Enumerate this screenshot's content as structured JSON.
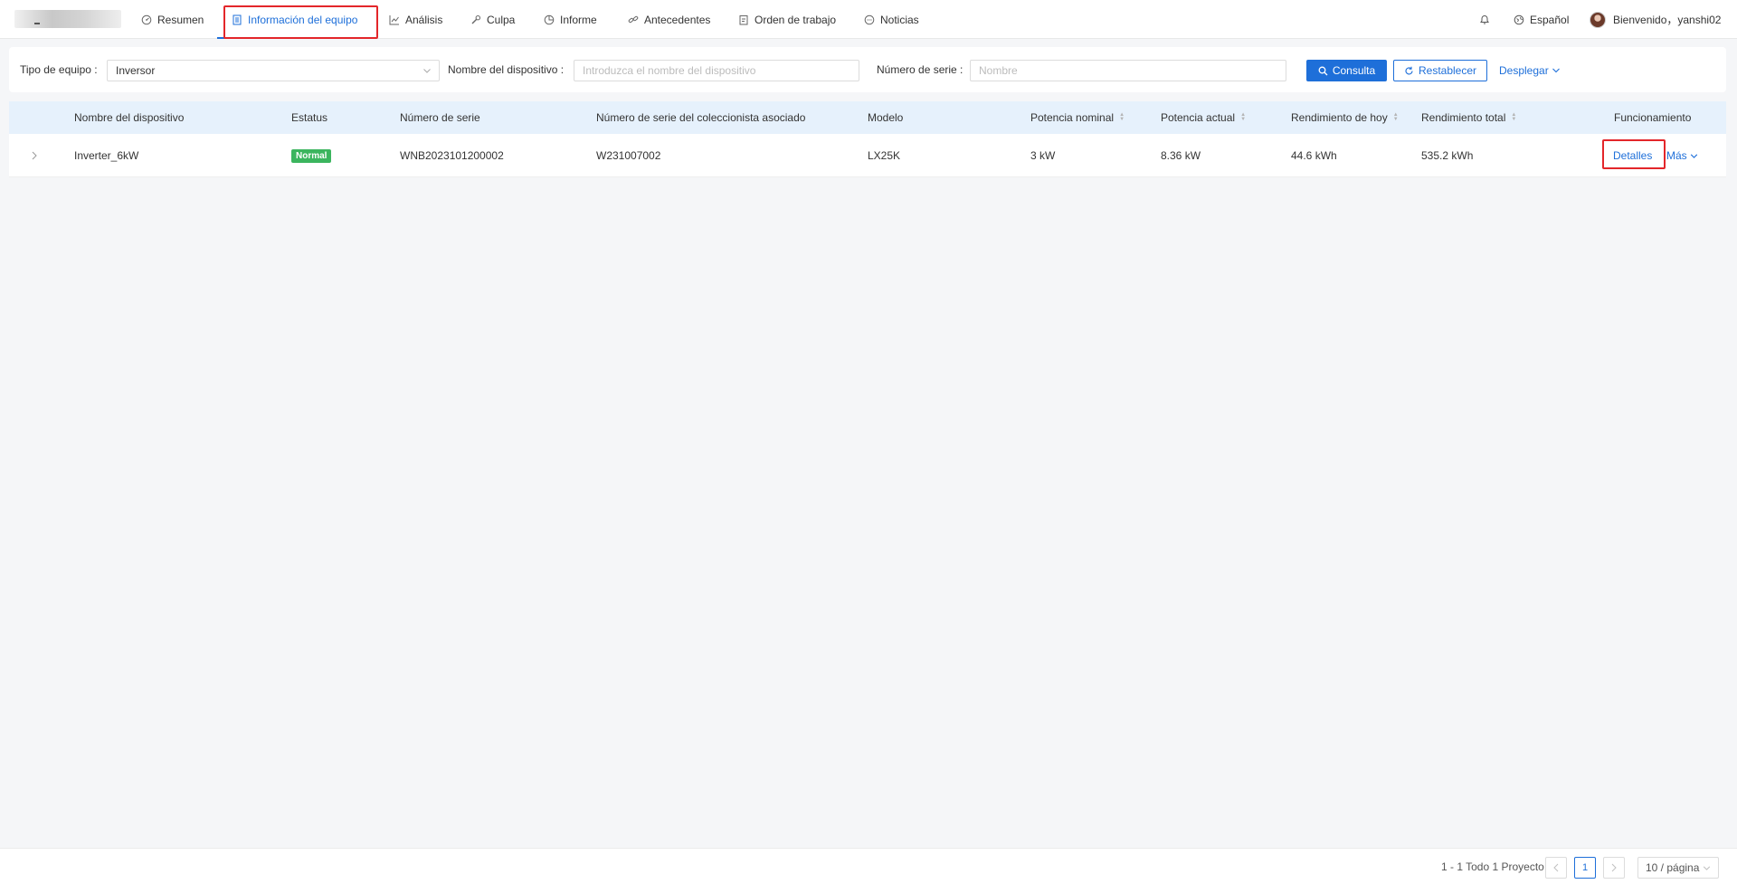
{
  "nav": {
    "items": [
      {
        "label": "Resumen",
        "icon": "gauge-icon"
      },
      {
        "label": "Información del equipo",
        "icon": "document-icon"
      },
      {
        "label": "Análisis",
        "icon": "line-chart-icon"
      },
      {
        "label": "Culpa",
        "icon": "wrench-icon"
      },
      {
        "label": "Informe",
        "icon": "pie-chart-icon"
      },
      {
        "label": "Antecedentes",
        "icon": "link-icon"
      },
      {
        "label": "Orden de trabajo",
        "icon": "clipboard-icon"
      },
      {
        "label": "Noticias",
        "icon": "chat-icon"
      }
    ],
    "active_index": 1,
    "language": "Español",
    "welcome": "Bienvenido，yanshi02"
  },
  "filter": {
    "type_label": "Tipo de equipo :",
    "type_value": "Inversor",
    "name_label": "Nombre del dispositivo :",
    "name_placeholder": "Introduzca el nombre del dispositivo",
    "serial_label": "Número de serie :",
    "serial_placeholder": "Nombre",
    "query_button": "Consulta",
    "reset_button": "Restablecer",
    "expand_link": "Desplegar"
  },
  "table": {
    "columns": [
      "Nombre del dispositivo",
      "Estatus",
      "Número de serie",
      "Número de serie del coleccionista asociado",
      "Modelo",
      "Potencia nominal",
      "Potencia actual",
      "Rendimiento de hoy",
      "Rendimiento total",
      "Funcionamiento"
    ],
    "rows": [
      {
        "name": "Inverter_6kW",
        "status": "Normal",
        "serial": "WNB2023101200002",
        "collector_serial": "W231007002",
        "model": "LX25K",
        "rated_power": "3 kW",
        "current_power": "8.36 kW",
        "yield_today": "44.6 kWh",
        "yield_total": "535.2 kWh",
        "details": "Detalles",
        "more": "Más"
      }
    ]
  },
  "pagination": {
    "summary": "1 - 1 Todo 1 Proyecto",
    "current_page": "1",
    "page_size": "10 / página"
  },
  "colors": {
    "primary": "#1e6fd9",
    "status_normal": "#3bb55e",
    "highlight": "#e3262a",
    "header_bg": "#e6f1fc"
  }
}
